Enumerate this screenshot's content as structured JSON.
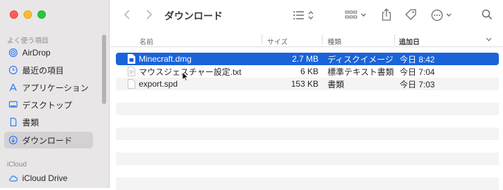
{
  "window": {
    "title": "ダウンロード"
  },
  "sidebar": {
    "sections": [
      {
        "label": "よく使う項目"
      },
      {
        "label": "iCloud"
      }
    ],
    "favorites": [
      {
        "label": "AirDrop",
        "icon": "airdrop-icon"
      },
      {
        "label": "最近の項目",
        "icon": "clock-icon"
      },
      {
        "label": "アプリケーション",
        "icon": "applications-icon"
      },
      {
        "label": "デスクトップ",
        "icon": "desktop-icon"
      },
      {
        "label": "書類",
        "icon": "document-icon"
      },
      {
        "label": "ダウンロード",
        "icon": "download-icon",
        "selected": true
      }
    ],
    "icloud": [
      {
        "label": "iCloud Drive",
        "icon": "cloud-icon"
      }
    ]
  },
  "columns": {
    "name": "名前",
    "size": "サイズ",
    "kind": "種類",
    "date": "追加日"
  },
  "files": [
    {
      "name": "Minecraft.dmg",
      "size": "2.7 MB",
      "kind": "ディスクイメージ",
      "date": "今日 8:42",
      "selected": true
    },
    {
      "name": "マウスジェスチャー設定.txt",
      "size": "6 KB",
      "kind": "標準テキスト書類",
      "date": "今日 7:04"
    },
    {
      "name": "export.spd",
      "size": "153 KB",
      "kind": "書類",
      "date": "今日 7:03"
    }
  ],
  "colors": {
    "accent": "#1a63d8",
    "sidebar_bg": "#e8e6e7",
    "icon_blue": "#2f7bf5"
  }
}
